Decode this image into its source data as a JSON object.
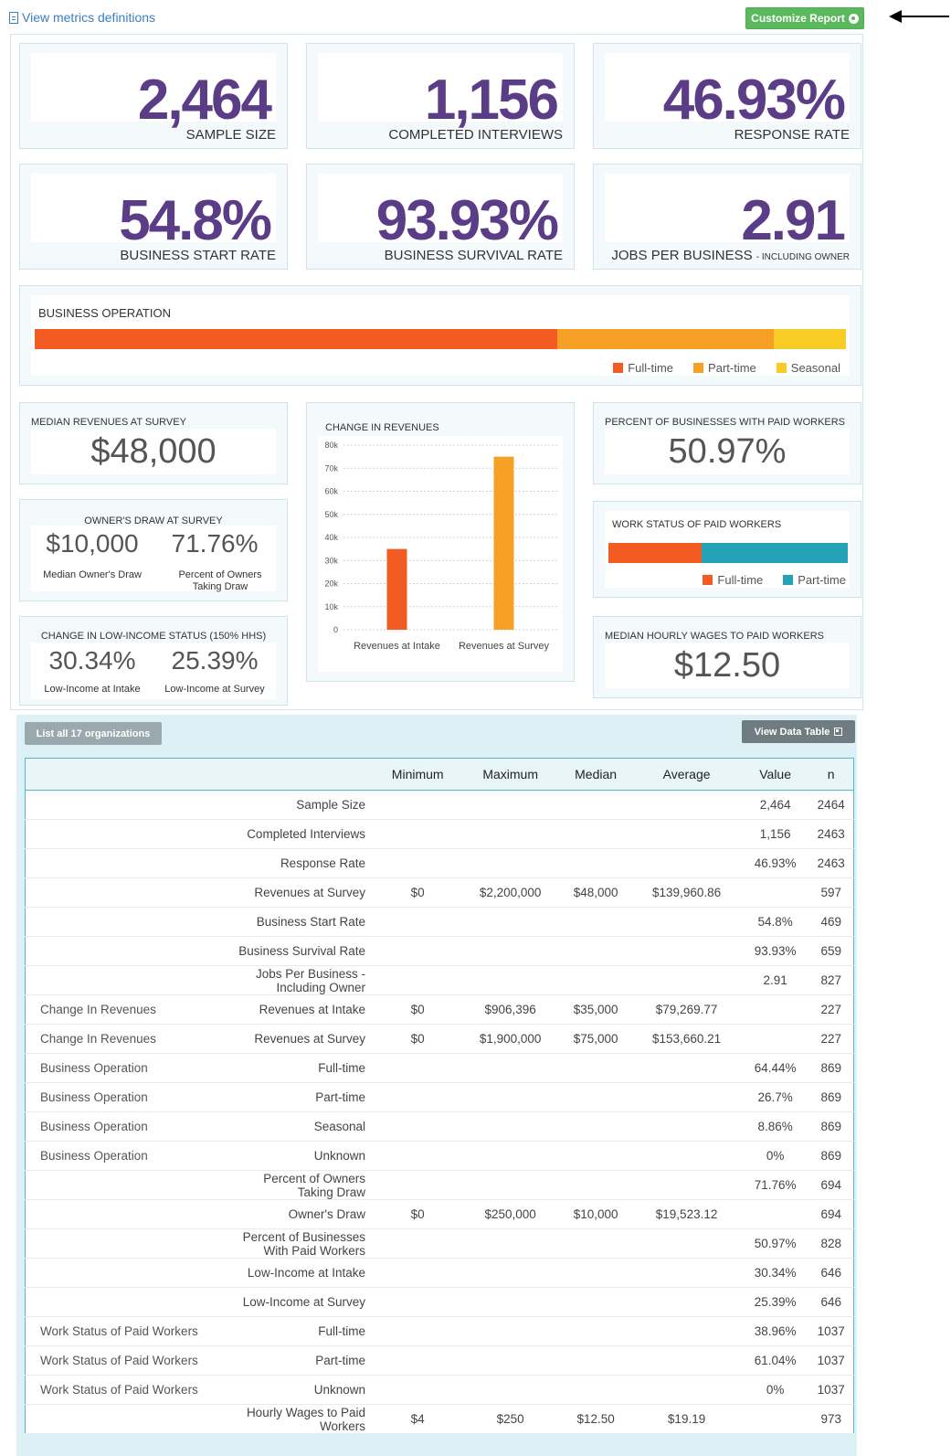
{
  "header": {
    "metrics_link": "View metrics definitions",
    "customize_button": "Customize Report"
  },
  "kpis": [
    {
      "value": "2,464",
      "label": "SAMPLE SIZE"
    },
    {
      "value": "1,156",
      "label": "COMPLETED INTERVIEWS"
    },
    {
      "value": "46.93%",
      "label": "RESPONSE RATE"
    },
    {
      "value": "54.8%",
      "label": "BUSINESS START RATE"
    },
    {
      "value": "93.93%",
      "label": "BUSINESS SURVIVAL RATE"
    },
    {
      "value": "2.91",
      "label": "JOBS PER BUSINESS",
      "label_suffix": "- INCLUDING OWNER"
    }
  ],
  "business_operation": {
    "title": "BUSINESS OPERATION",
    "segments": [
      {
        "name": "Full-time",
        "percent": 64.44,
        "color": "#f25c23"
      },
      {
        "name": "Part-time",
        "percent": 26.7,
        "color": "#f6a025"
      },
      {
        "name": "Seasonal",
        "percent": 8.86,
        "color": "#f9cb25"
      }
    ]
  },
  "median_revenues": {
    "title": "MEDIAN REVENUES AT SURVEY",
    "value": "$48,000"
  },
  "owners_draw": {
    "title": "OWNER'S DRAW AT SURVEY",
    "left_value": "$10,000",
    "left_label": "Median Owner's Draw",
    "right_value": "71.76%",
    "right_label": "Percent of Owners Taking Draw"
  },
  "low_income": {
    "title": "CHANGE IN LOW-INCOME STATUS (150% HHS)",
    "left_value": "30.34%",
    "left_label": "Low-Income at Intake",
    "right_value": "25.39%",
    "right_label": "Low-Income at Survey"
  },
  "paid_workers": {
    "title": "PERCENT OF BUSINESSES WITH PAID WORKERS",
    "value": "50.97%"
  },
  "work_status": {
    "title": "WORK STATUS OF PAID WORKERS",
    "segments": [
      {
        "name": "Full-time",
        "percent": 38.96,
        "color": "#f25c23"
      },
      {
        "name": "Part-time",
        "percent": 61.04,
        "color": "#23a3b5"
      }
    ]
  },
  "hourly_wages": {
    "title": "MEDIAN HOURLY WAGES TO PAID WORKERS",
    "value": "$12.50"
  },
  "chart_data": {
    "type": "bar",
    "title": "CHANGE IN REVENUES",
    "categories": [
      "Revenues at Intake",
      "Revenues at Survey"
    ],
    "values": [
      35000,
      75000
    ],
    "colors": [
      "#f25c23",
      "#f6a025"
    ],
    "yticks": [
      "0",
      "10k",
      "20k",
      "30k",
      "40k",
      "50k",
      "60k",
      "70k",
      "80k"
    ],
    "ylim": [
      0,
      80000
    ],
    "grid": true,
    "xlabel": "",
    "ylabel": ""
  },
  "table": {
    "list_button": "List all 17 organizations",
    "view_button": "View Data Table",
    "columns": [
      "",
      "",
      "Minimum",
      "Maximum",
      "Median",
      "Average",
      "Value",
      "n"
    ],
    "rows": [
      [
        "",
        "Sample Size",
        "",
        "",
        "",
        "",
        "2,464",
        "2464"
      ],
      [
        "",
        "Completed Interviews",
        "",
        "",
        "",
        "",
        "1,156",
        "2463"
      ],
      [
        "",
        "Response Rate",
        "",
        "",
        "",
        "",
        "46.93%",
        "2463"
      ],
      [
        "",
        "Revenues at Survey",
        "$0",
        "$2,200,000",
        "$48,000",
        "$139,960.86",
        "",
        "597"
      ],
      [
        "",
        "Business Start Rate",
        "",
        "",
        "",
        "",
        "54.8%",
        "469"
      ],
      [
        "",
        "Business Survival Rate",
        "",
        "",
        "",
        "",
        "93.93%",
        "659"
      ],
      [
        "",
        "Jobs Per Business - Including Owner",
        "",
        "",
        "",
        "",
        "2.91",
        "827"
      ],
      [
        "Change In Revenues",
        "Revenues at Intake",
        "$0",
        "$906,396",
        "$35,000",
        "$79,269.77",
        "",
        "227"
      ],
      [
        "Change In Revenues",
        "Revenues at Survey",
        "$0",
        "$1,900,000",
        "$75,000",
        "$153,660.21",
        "",
        "227"
      ],
      [
        "Business Operation",
        "Full-time",
        "",
        "",
        "",
        "",
        "64.44%",
        "869"
      ],
      [
        "Business Operation",
        "Part-time",
        "",
        "",
        "",
        "",
        "26.7%",
        "869"
      ],
      [
        "Business Operation",
        "Seasonal",
        "",
        "",
        "",
        "",
        "8.86%",
        "869"
      ],
      [
        "Business Operation",
        "Unknown",
        "",
        "",
        "",
        "",
        "0%",
        "869"
      ],
      [
        "",
        "Percent of Owners Taking Draw",
        "",
        "",
        "",
        "",
        "71.76%",
        "694"
      ],
      [
        "",
        "Owner's Draw",
        "$0",
        "$250,000",
        "$10,000",
        "$19,523.12",
        "",
        "694"
      ],
      [
        "",
        "Percent of Businesses With Paid Workers",
        "",
        "",
        "",
        "",
        "50.97%",
        "828"
      ],
      [
        "",
        "Low-Income at Intake",
        "",
        "",
        "",
        "",
        "30.34%",
        "646"
      ],
      [
        "",
        "Low-Income at Survey",
        "",
        "",
        "",
        "",
        "25.39%",
        "646"
      ],
      [
        "Work Status of Paid Workers",
        "Full-time",
        "",
        "",
        "",
        "",
        "38.96%",
        "1037"
      ],
      [
        "Work Status of Paid Workers",
        "Part-time",
        "",
        "",
        "",
        "",
        "61.04%",
        "1037"
      ],
      [
        "Work Status of Paid Workers",
        "Unknown",
        "",
        "",
        "",
        "",
        "0%",
        "1037"
      ],
      [
        "",
        "Hourly Wages to Paid Workers",
        "$4",
        "$250",
        "$12.50",
        "$19.19",
        "",
        "973"
      ]
    ]
  }
}
